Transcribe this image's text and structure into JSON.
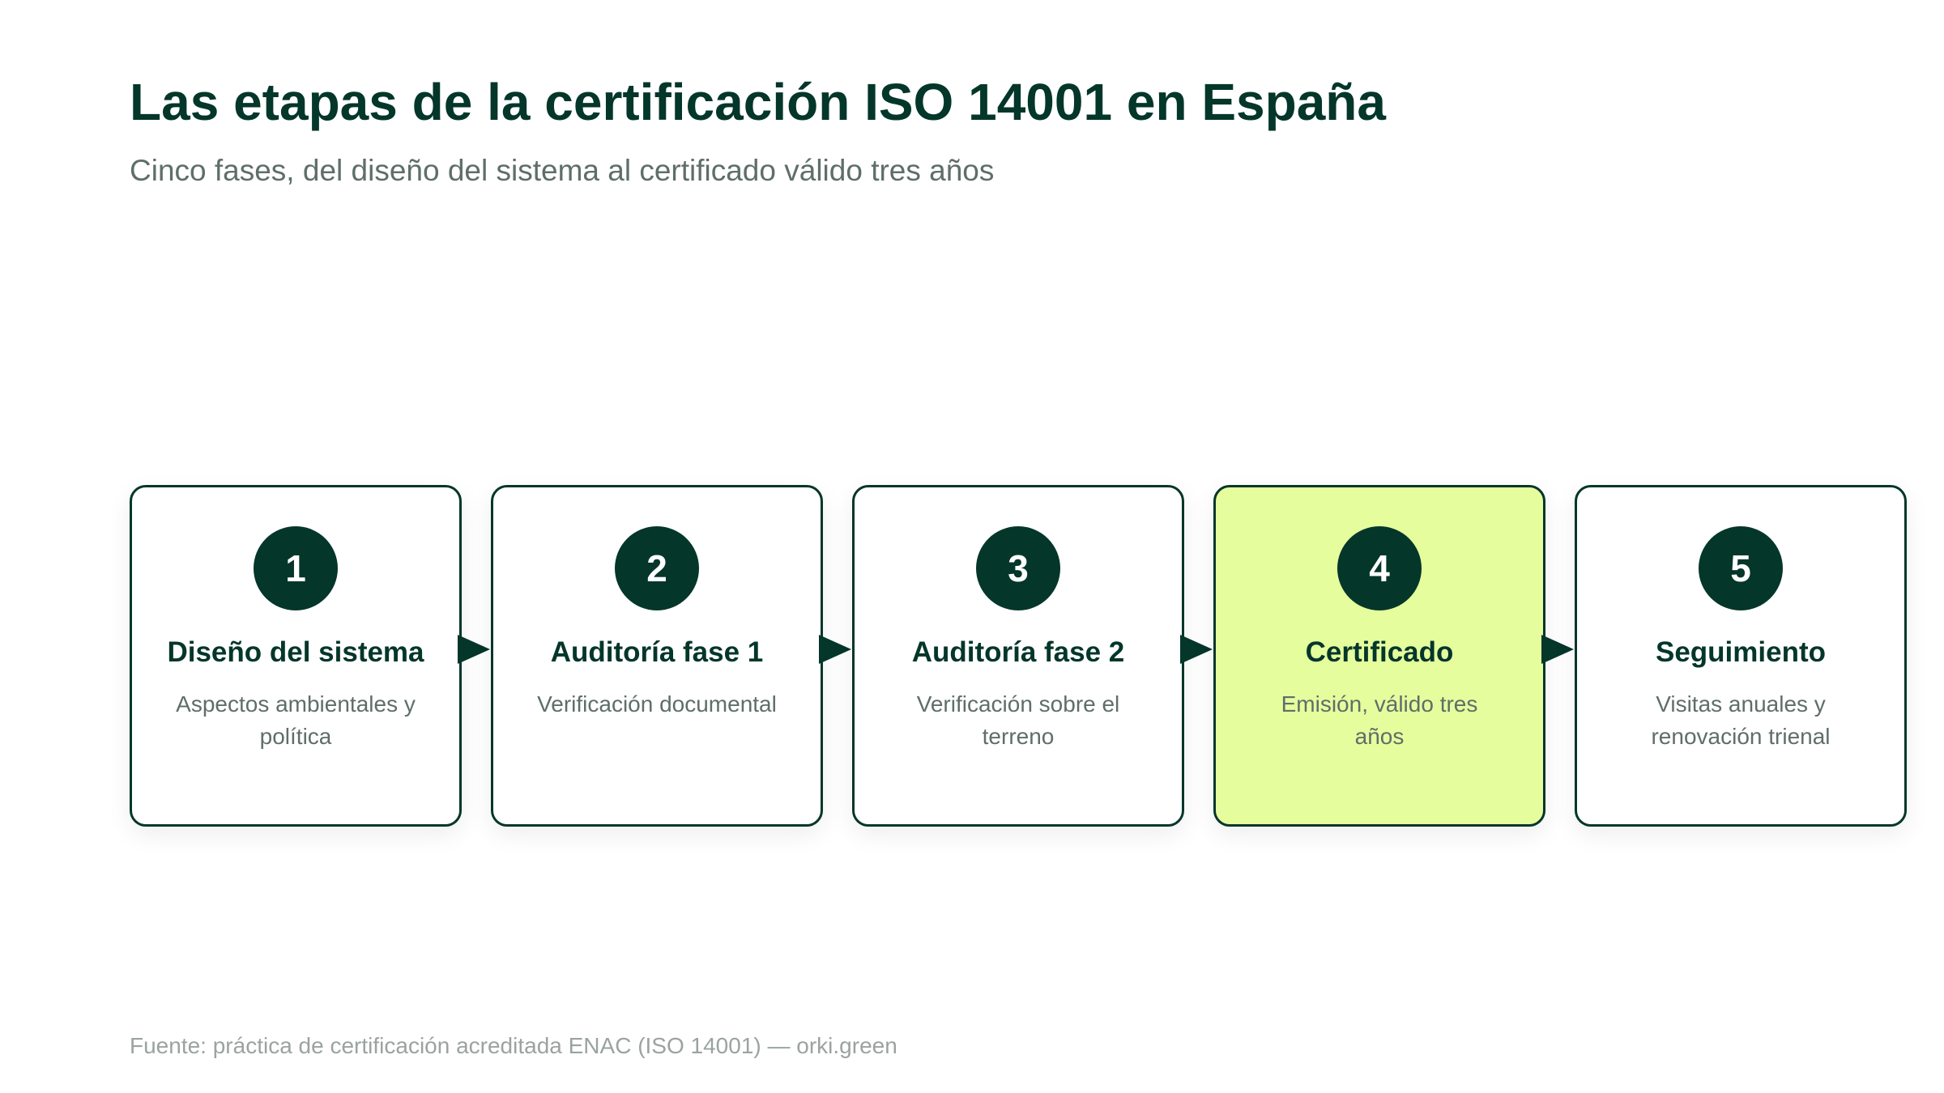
{
  "header": {
    "title": "Las etapas de la certificación ISO 14001 en España",
    "subtitle": "Cinco fases, del diseño del sistema al certificado válido tres años"
  },
  "steps": [
    {
      "number": "1",
      "title": "Diseño del sistema",
      "description": "Aspectos ambientales y política",
      "highlighted": false
    },
    {
      "number": "2",
      "title": "Auditoría fase 1",
      "description": "Verificación documental",
      "highlighted": false
    },
    {
      "number": "3",
      "title": "Auditoría fase 2",
      "description": "Verificación sobre el terreno",
      "highlighted": false
    },
    {
      "number": "4",
      "title": "Certificado",
      "description": "Emisión, válido tres años",
      "highlighted": true
    },
    {
      "number": "5",
      "title": "Seguimiento",
      "description": "Visitas anuales y renovación trienal",
      "highlighted": false
    }
  ],
  "footer": {
    "source": "Fuente: práctica de certificación acreditada ENAC (ISO 14001) — orki.green"
  },
  "colors": {
    "primary": "#04362a",
    "highlight": "#e6fd9e",
    "muted_text": "#5f6e69",
    "footer_text": "#9aa3a0"
  }
}
